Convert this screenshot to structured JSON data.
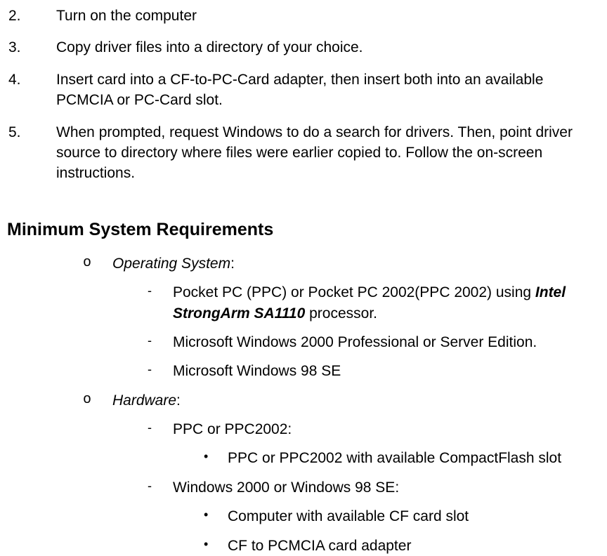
{
  "steps": {
    "s2": {
      "num": "2.",
      "text": "Turn on the computer"
    },
    "s3": {
      "num": "3.",
      "text": "Copy driver files into a directory of your choice."
    },
    "s4": {
      "num": "4.",
      "text": "Insert card into a CF-to-PC-Card adapter, then insert both into an available PCMCIA or PC-Card slot."
    },
    "s5": {
      "num": "5.",
      "text": "When prompted, request Windows to do a search for drivers.  Then, point driver source to directory where files were earlier copied to.  Follow the on-screen instructions."
    }
  },
  "heading": "Minimum System Requirements",
  "os": {
    "marker": "o",
    "label": "Operating System",
    "colon": ":",
    "items": {
      "a": {
        "dash": "-",
        "pre": "Pocket PC (PPC) or  Pocket PC 2002(PPC 2002) using ",
        "bold": "Intel StrongArm SA1110",
        "post": " processor."
      },
      "b": {
        "dash": "-",
        "text": "Microsoft Windows 2000 Professional or Server Edition."
      },
      "c": {
        "dash": "-",
        "text": "Microsoft Windows 98 SE"
      }
    }
  },
  "hw": {
    "marker": "o",
    "label": "Hardware",
    "colon": ":",
    "items": {
      "a": {
        "dash": "-",
        "text": "PPC or PPC2002:"
      },
      "a1": {
        "bullet": "•",
        "text": "PPC or PPC2002 with available CompactFlash slot"
      },
      "b": {
        "dash": "-",
        "text": "Windows 2000 or Windows 98 SE:"
      },
      "b1": {
        "bullet": "•",
        "text": "Computer with available CF card slot"
      },
      "b2": {
        "bullet": "•",
        "text": "CF to PCMCIA card adapter"
      }
    }
  }
}
